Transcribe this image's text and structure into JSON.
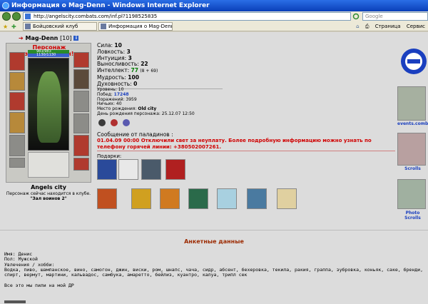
{
  "window": {
    "title": "Информация о Mag-Denn - Windows Internet Explorer"
  },
  "address_bar": {
    "url": "http://angelscity.combats.com/inf.pl?1198525835",
    "search_placeholder": "Google"
  },
  "tabs": [
    {
      "label": "Бойцовский клуб"
    },
    {
      "label": "Информация о Mag-Denn"
    }
  ],
  "toolbar": {
    "page_label": "Страница",
    "service_label": "Сервис"
  },
  "character": {
    "nick": "Mag-Denn",
    "level": "[10]",
    "blocked_text": "Персонаж заблокирован!",
    "hp": "983/983",
    "mp": "1130/1130",
    "city": "Angels city",
    "location_line1": "Персонаж сейчас находится в клубе.",
    "location_line2": "\"Зал воинов 2\""
  },
  "stats": {
    "strength_label": "Сила:",
    "strength": "10",
    "agility_label": "Ловкость:",
    "agility": "3",
    "intuition_label": "Интуиция:",
    "intuition": "3",
    "endurance_label": "Выносливость:",
    "endurance": "22",
    "intellect_label": "Интеллект:",
    "intellect": "77",
    "intellect_bonus": "(8 + 69)",
    "wisdom_label": "Мудрость:",
    "wisdom": "100",
    "spirituality_label": "Духовность:",
    "spirituality": "0"
  },
  "info": {
    "level": "Уровень: 10",
    "wins_label": "Побед:",
    "wins": "17248",
    "losses": "Поражений: 3959",
    "draws": "Ничьих: 40",
    "birthplace_label": "Место рождения:",
    "birthplace": "Old city",
    "birthday": "День рождения персонажа: 25.12.07 12:50"
  },
  "paladins": {
    "title": "Сообщение от паладинов :",
    "message": "01.04.09 00:00 Отключили свет за неуплату. Более подробную информацию можно узнать по телефону горячей линии: +380502007261."
  },
  "gifts": {
    "title": "Подарки:"
  },
  "scrolls": {
    "events_label": "events.combats.c",
    "scrolls_label": "Scrolls",
    "photo_label": "Photo Scrolls"
  },
  "profile": {
    "section_title": "Анкетные данные",
    "name": "Имя: Денис",
    "gender": "Пол: Мужской",
    "hobbies_label": "Увлечения / хобби:",
    "hobbies_line1": "Водка, пиво, шампанское, вино, самогон, джин, виски, ром, шнапс, чача, сидр, абсент, бехеровка, текила, ракия, граппа, зубровка, коньяк, саке, бренди,",
    "hobbies_line2": "спирт, вермут, мартини, кальвадос, самбука, амаретто, бейлиз, куантро, калуа, трипл сек",
    "closing": "Все это мы пили на мой ДР"
  },
  "colors": {
    "blocked_red": "#d00000",
    "link_blue": "#1a3fbf",
    "section_brown": "#9c2a00",
    "titlebar_blue": "#0a3fb8",
    "intellect_green": "#007a00"
  }
}
